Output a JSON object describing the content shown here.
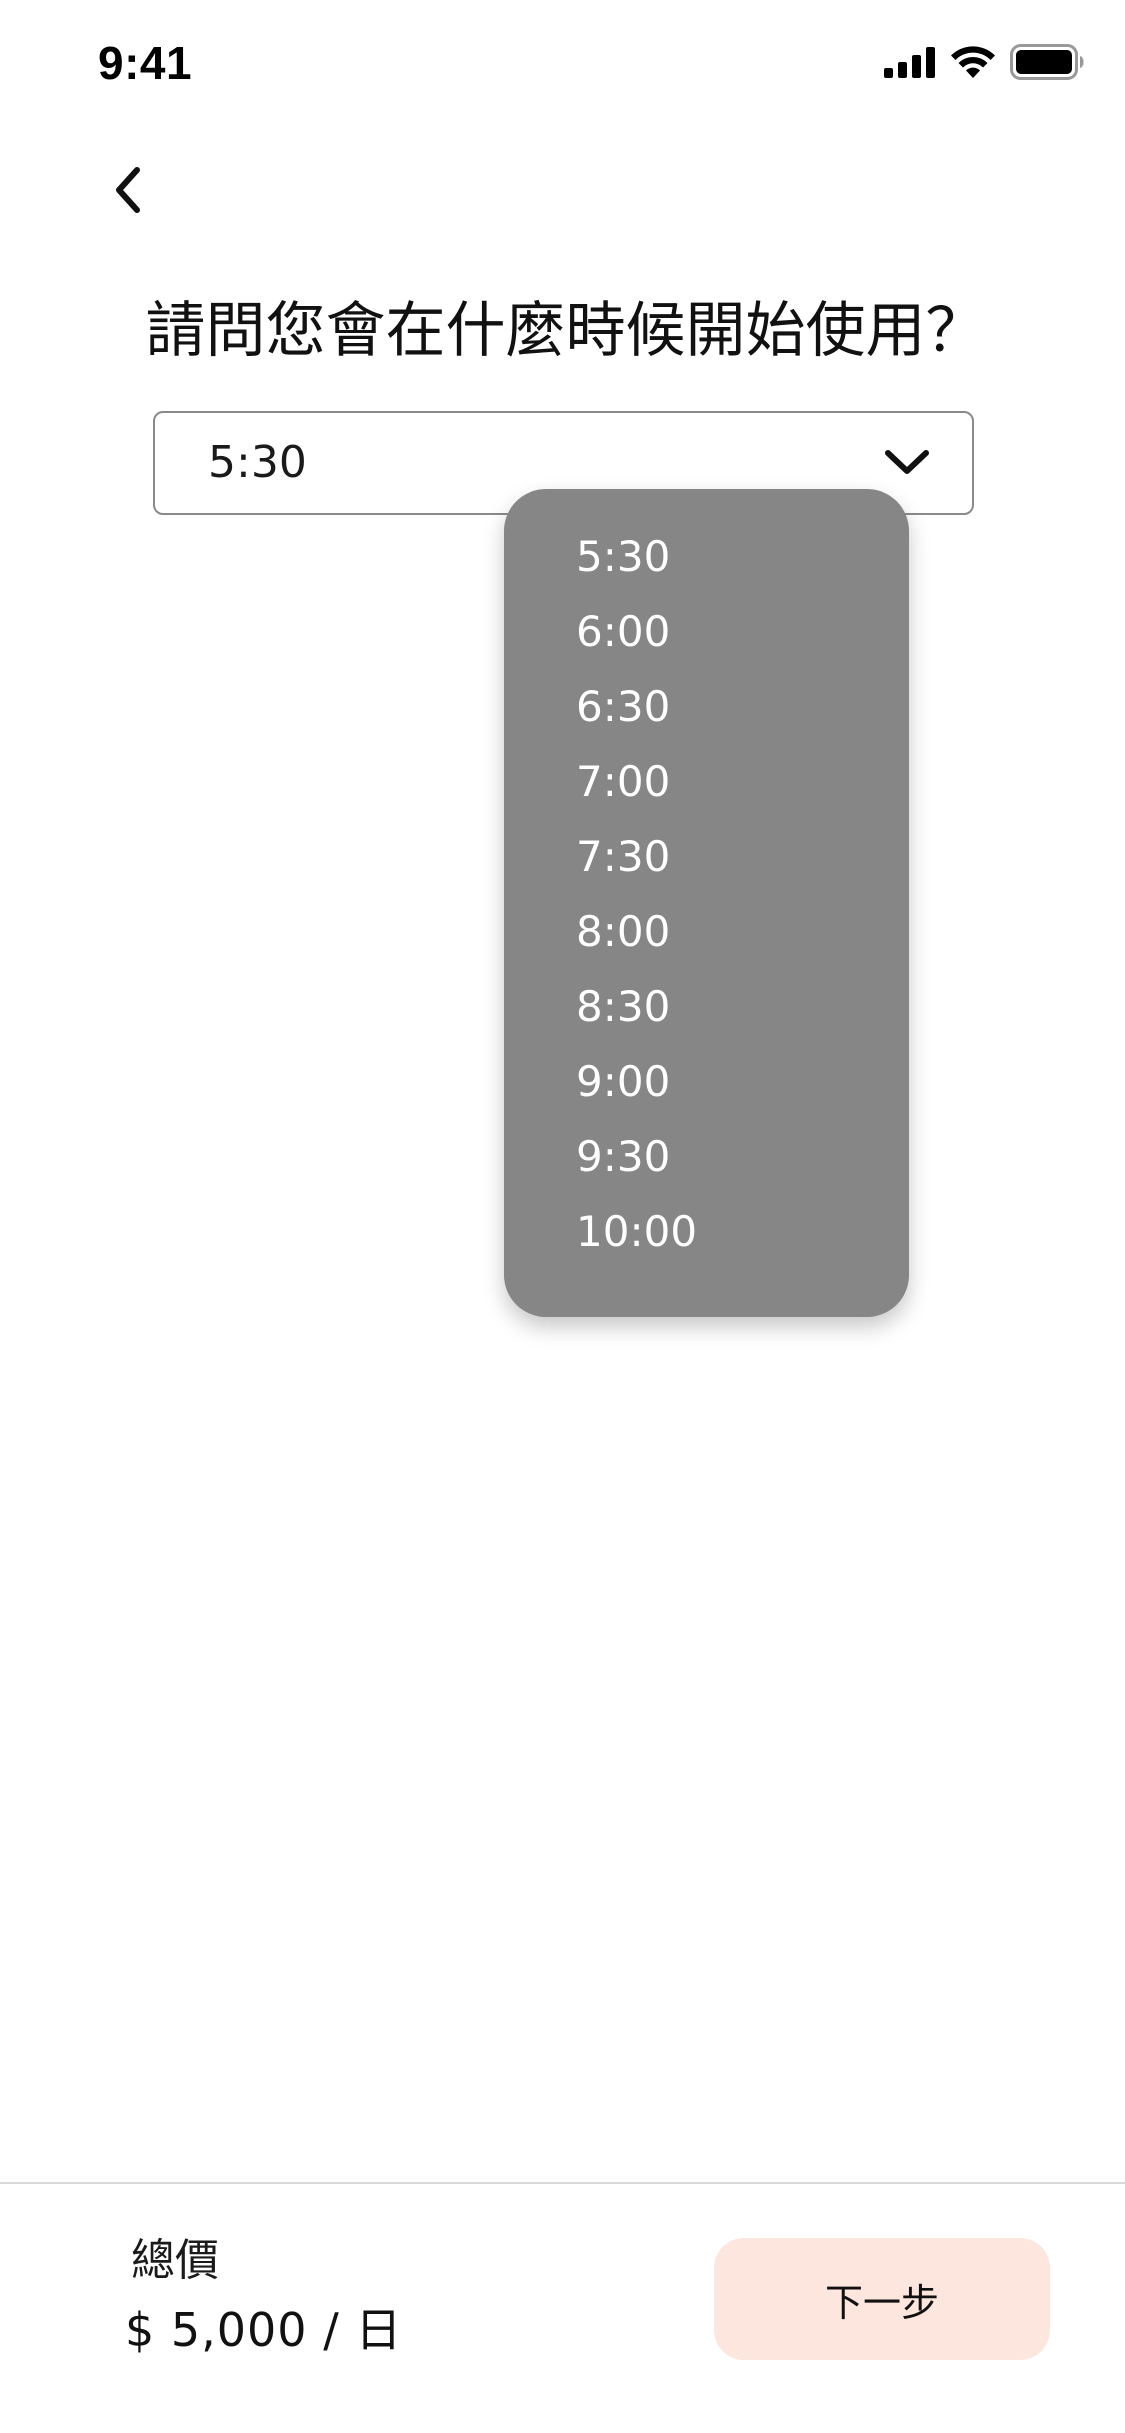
{
  "status_bar": {
    "time": "9:41"
  },
  "header": {
    "back_icon": "chevron-left-icon"
  },
  "question": {
    "text": "請問您會在什麼時候開始使用？"
  },
  "select": {
    "value": "5:30",
    "icon": "chevron-down-icon"
  },
  "dropdown": {
    "options": [
      "5:30",
      "6:00",
      "6:30",
      "7:00",
      "7:30",
      "8:00",
      "8:30",
      "9:00",
      "9:30",
      "10:00"
    ]
  },
  "footer": {
    "total_label": "總價",
    "total_price": "$ 5,000 / 日",
    "next_label": "下一步"
  },
  "colors": {
    "dropdown_bg": "#878687",
    "next_button_bg": "#fde6dd",
    "select_border": "#8a8a8a"
  }
}
